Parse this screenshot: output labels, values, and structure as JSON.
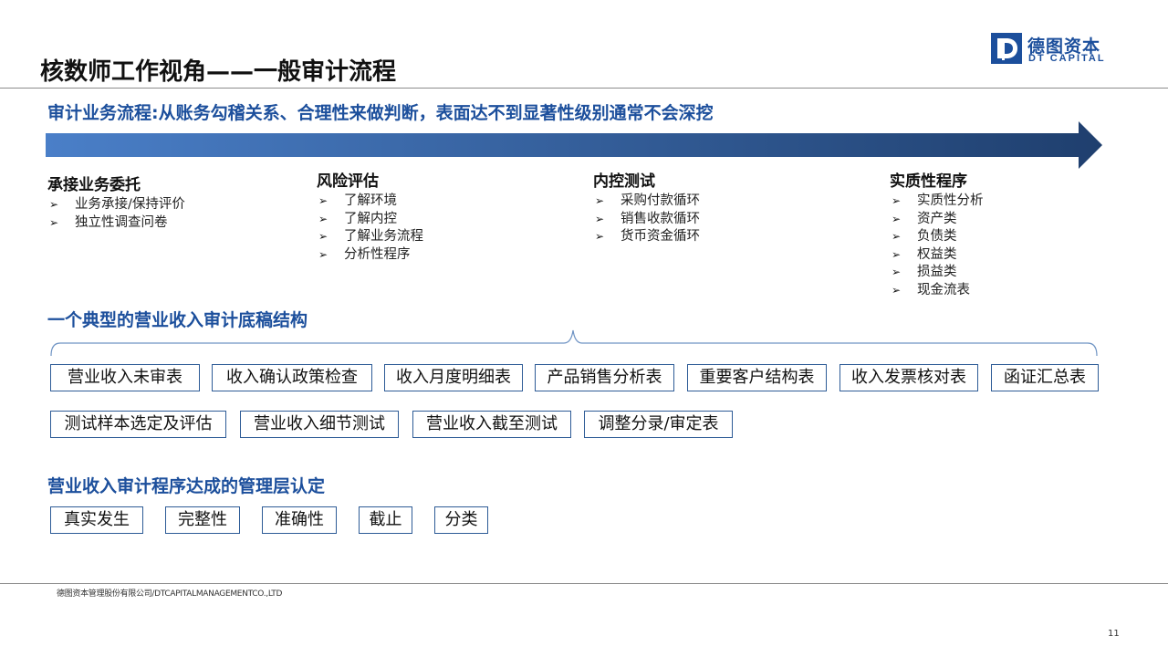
{
  "slide": {
    "title": "核数师工作视角——一般审计流程",
    "subtitle": "审计业务流程:从账务勾稽关系、合理性来做判断，表面达不到显著性级别通常不会深挖"
  },
  "logo": {
    "mark_letter": "D",
    "name_cn": "德图资本",
    "name_en": "DT CAPITAL",
    "brand_color": "#1c4f9c"
  },
  "stages": [
    {
      "title": "承接业务委托",
      "items": [
        "业务承接/保持评价",
        "独立性调查问卷"
      ]
    },
    {
      "title": "风险评估",
      "items": [
        "了解环境",
        "了解内控",
        "了解业务流程",
        "分析性程序"
      ]
    },
    {
      "title": "内控测试",
      "items": [
        "采购付款循环",
        "销售收款循环",
        "货币资金循环"
      ]
    },
    {
      "title": "实质性程序",
      "items": [
        "实质性分析",
        "资产类",
        "负债类",
        "权益类",
        "损益类",
        "现金流表"
      ]
    }
  ],
  "bullet_glyph": "➢",
  "section_structure": {
    "title": "一个典型的营业收入审计底稿结构",
    "row1": [
      "营业收入未审表",
      "收入确认政策检查",
      "收入月度明细表",
      "产品销售分析表",
      "重要客户结构表",
      "收入发票核对表",
      "函证汇总表"
    ],
    "row2": [
      "测试样本选定及评估",
      "营业收入细节测试",
      "营业收入截至测试",
      "调整分录/审定表"
    ]
  },
  "section_assertions": {
    "title": "营业收入审计程序达成的管理层认定",
    "items": [
      "真实发生",
      "完整性",
      "准确性",
      "截止",
      "分类"
    ]
  },
  "footer": {
    "company": "德图资本管理股份有限公司/DTCAPITALMANAGEMENTCO.,LTD",
    "page_number": "11"
  },
  "colors": {
    "accent": "#1c4f9c",
    "arrow_start": "#4a7fc8",
    "arrow_end": "#1f3f6e",
    "box_border": "#2d5b96"
  }
}
